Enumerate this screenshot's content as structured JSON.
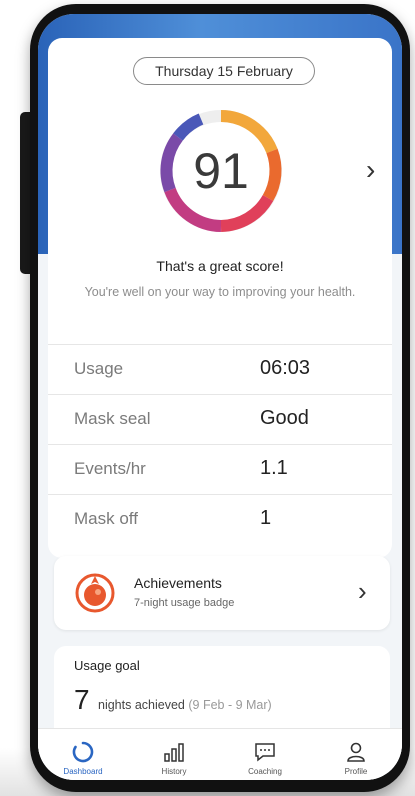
{
  "date_label": "Thursday 15 February",
  "score": {
    "value": "91",
    "gauge_level": 0.91,
    "message": "That's a great score!",
    "sub_message": "You're well on your way to improving your health."
  },
  "metrics": [
    {
      "label": "Usage",
      "value": "06:03"
    },
    {
      "label": "Mask seal",
      "value": "Good"
    },
    {
      "label": "Events/hr",
      "value": "1.1"
    },
    {
      "label": "Mask off",
      "value": "1"
    }
  ],
  "achievements": {
    "title": "Achievements",
    "subtitle": "7-night usage badge"
  },
  "usage_goal": {
    "title": "Usage goal",
    "count": "7",
    "text": "nights achieved",
    "range": "(9 Feb - 9 Mar)"
  },
  "nav": [
    {
      "label": "Dashboard",
      "icon": "dashboard-ring-icon"
    },
    {
      "label": "History",
      "icon": "bar-chart-icon"
    },
    {
      "label": "Coaching",
      "icon": "chat-bubble-icon"
    },
    {
      "label": "Profile",
      "icon": "person-icon"
    }
  ],
  "colors": {
    "accent": "#2a66c2",
    "badge": "#e8582e"
  }
}
